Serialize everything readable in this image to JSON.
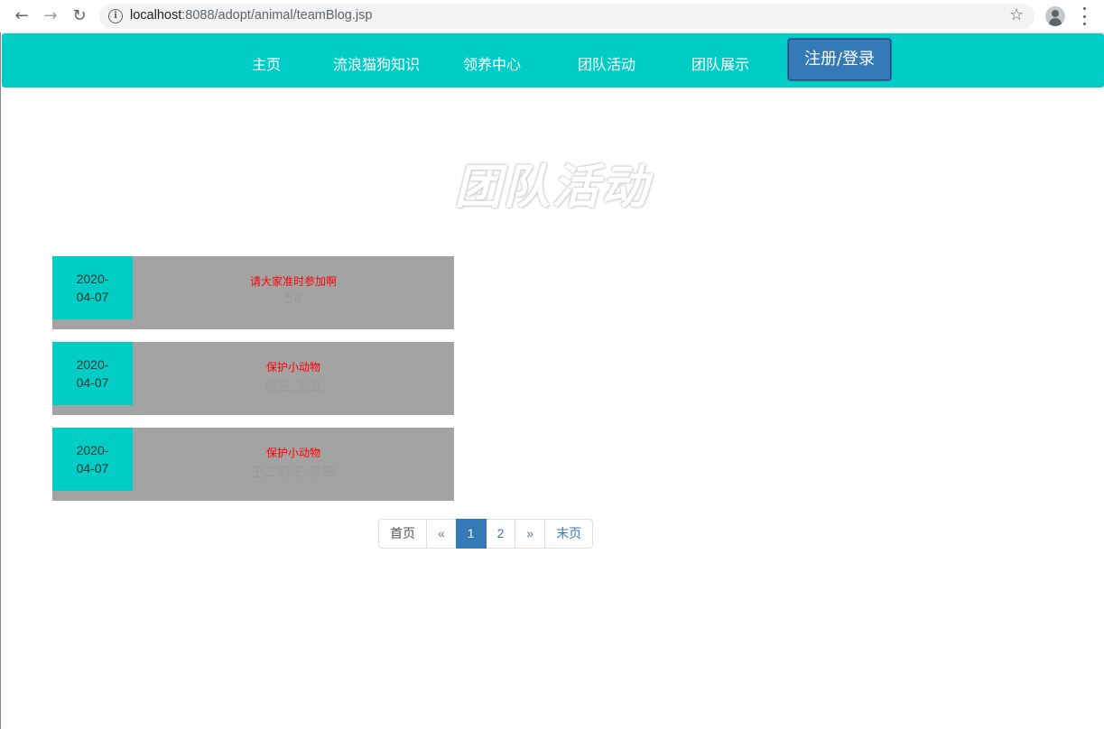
{
  "browser": {
    "url_host": "localhost",
    "url_rest": ":8088/adopt/animal/teamBlog.jsp"
  },
  "navbar": {
    "items": [
      {
        "label": "主页"
      },
      {
        "label": "流浪猫狗知识"
      },
      {
        "label": "领养中心"
      },
      {
        "label": "团队活动"
      },
      {
        "label": "团队展示"
      }
    ],
    "login_label": "注册/登录",
    "accent_color": "#00cdc5",
    "button_color": "#337ab7"
  },
  "hero": {
    "title": "团队活动"
  },
  "blogs": [
    {
      "date_year": "2020-",
      "date_md": "04-07",
      "title": "请大家准时参加啊",
      "members": "54"
    },
    {
      "date_year": "2020-",
      "date_md": "04-07",
      "title": "保护小动物",
      "members": "张三,王五"
    },
    {
      "date_year": "2020-",
      "date_md": "04-07",
      "title": "保护小动物",
      "members": "王二麻子,李四"
    }
  ],
  "pagination": {
    "first": "首页",
    "prev": "«",
    "pages": [
      "1",
      "2"
    ],
    "current": "1",
    "next": "»",
    "last": "末页"
  }
}
